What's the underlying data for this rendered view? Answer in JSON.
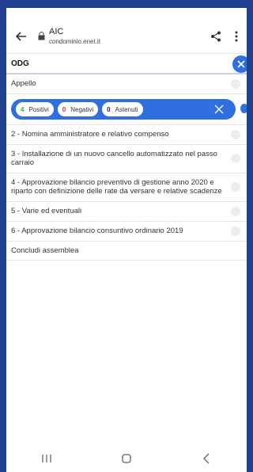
{
  "browser": {
    "title": "AIC",
    "url": "condominio.enet.it"
  },
  "odg": {
    "title": "ODG"
  },
  "agenda": [
    {
      "label": "Appello"
    },
    {
      "label": "2 - Nomina amministratore e relativo compenso"
    },
    {
      "label": "3 - Installazione di un nuovo cancello automatizzato nel passo carraio"
    },
    {
      "label": "4 - Approvazione bilancio preventivo di gestione anno 2020 e riparto con definizione delle rate da versare e relative scadenze"
    },
    {
      "label": "5 - Varie ed eventuali"
    },
    {
      "label": "6 - Approvazione bilancio consuntivo ordinario 2019"
    },
    {
      "label": "Concludi assemblea"
    }
  ],
  "votes": {
    "positive_count": "4",
    "positive_label": "Positivi",
    "negative_count": "0",
    "negative_label": "Negativi",
    "abstained_count": "0",
    "abstained_label": "Astenuti"
  },
  "colors": {
    "accent": "#2f6fe0",
    "frame": "#1f3f8f",
    "positive": "#2bb24c",
    "negative": "#e02424"
  }
}
